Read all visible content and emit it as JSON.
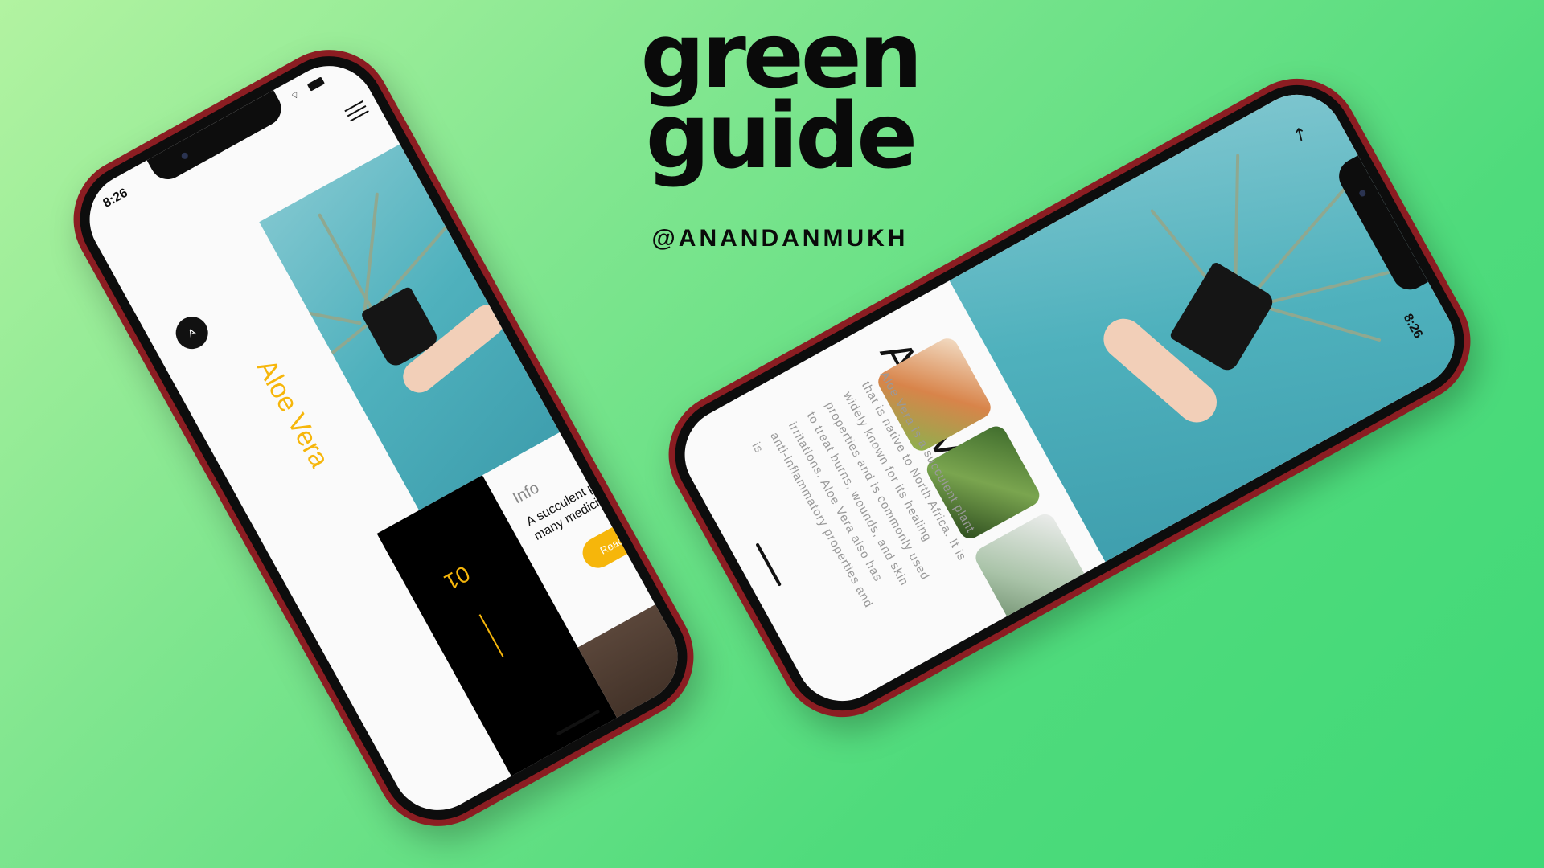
{
  "brand": {
    "title_line1": "green",
    "title_line2": "guide",
    "handle": "@ANANDANMUKH"
  },
  "phone_portrait": {
    "status_time": "8:26",
    "avatar_letter": "A",
    "plant_name": "Aloe Vera",
    "index_number": "01",
    "info_label": "Info",
    "info_text": "A succulent plant with many medicinal properties",
    "read_more_label": "Read More"
  },
  "phone_landscape": {
    "status_time": "8:26",
    "plant_name": "Aloe Vera",
    "description": "Aloe Vera is a succulent plant that is native to North Africa. It is widely known for its healing properties and is commonly used to treat burns, wounds, and skin irritations. Aloe Vera also has anti-inflammatory properties and is",
    "thumbnails": [
      "cactus-pots-thumbnail",
      "aloe-closeup-thumbnail",
      "aloe-leaf-thumbnail"
    ]
  },
  "colors": {
    "accent_yellow": "#f6b60b",
    "phone_frame": "#8b1d22",
    "hero_teal": "#4fb1bd",
    "bg_green": "#4fdb7c"
  }
}
